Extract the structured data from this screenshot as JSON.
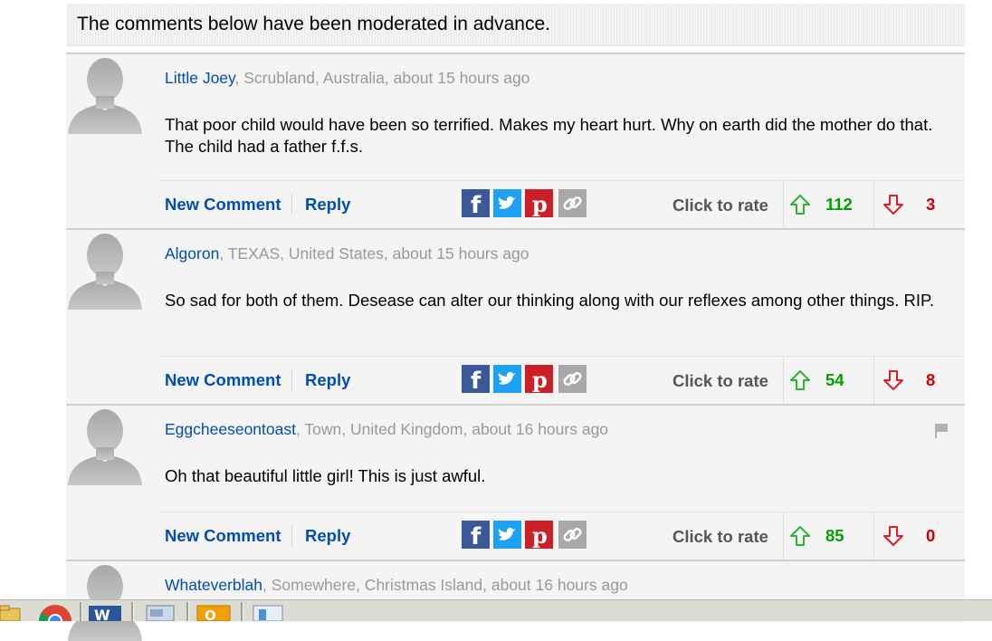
{
  "notice": "The comments below have been moderated in advance.",
  "actions": {
    "new_comment": "New Comment",
    "reply": "Reply",
    "click_to_rate": "Click to rate"
  },
  "comments": [
    {
      "author": "Little Joey",
      "location_time": ", Scrubland, Australia, about 15 hours ago",
      "text": "That poor child would have been so terrified. Makes my heart hurt. Why on earth did the mother do that. The child had a father f.f.s.",
      "up": "112",
      "down": "3"
    },
    {
      "author": "Algoron",
      "location_time": ", TEXAS, United States, about 15 hours ago",
      "text": "So sad for both of them. Desease can alter our thinking along with our reflexes among other things. RIP.",
      "up": "54",
      "down": "8"
    },
    {
      "author": "Eggcheeseontoast",
      "location_time": ", Town, United Kingdom, about 16 hours ago",
      "text": "Oh that beautiful little girl! This is just awful.",
      "up": "85",
      "down": "0"
    },
    {
      "author": "Whateverblah",
      "location_time": ", Somewhere, Christmas Island, about 16 hours ago"
    }
  ],
  "colors": {
    "author": "#004db3",
    "up": "#00a000",
    "down": "#d40000",
    "facebook": "#3b5998",
    "twitter": "#1da1f2",
    "pinterest": "#cb2027"
  },
  "icons": [
    "avatar-silhouette-icon",
    "facebook-icon",
    "twitter-icon",
    "pinterest-icon",
    "link-icon",
    "thumb-up-arrow-icon",
    "thumb-down-arrow-icon",
    "flag-icon"
  ]
}
